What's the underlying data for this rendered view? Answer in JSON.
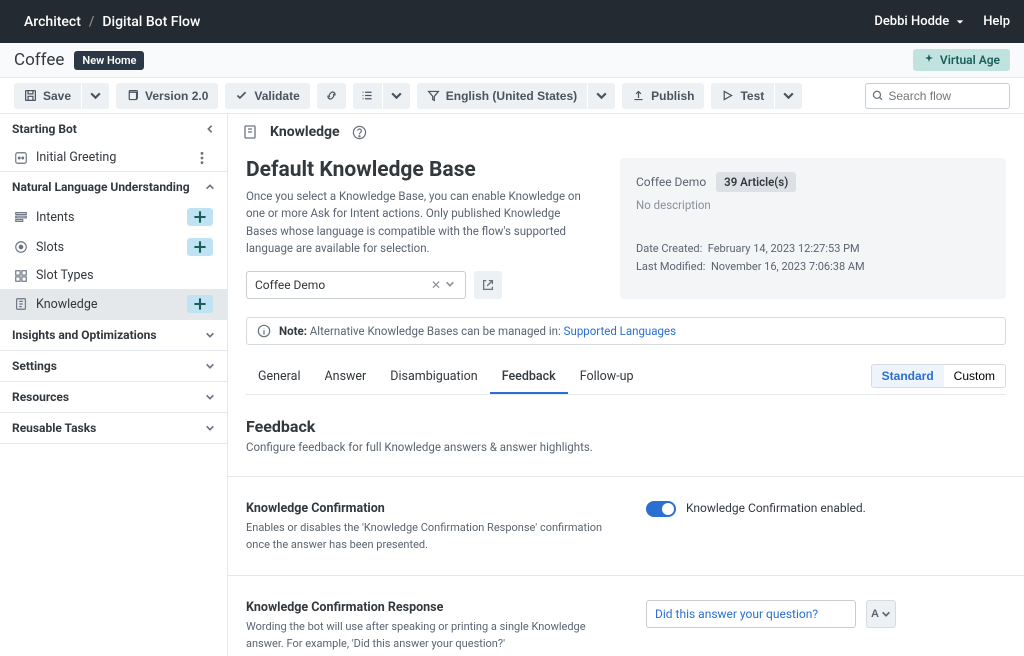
{
  "topbar": {
    "breadcrumb1": "Architect",
    "breadcrumb2": "Digital Bot Flow",
    "user": "Debbi Hodde",
    "help": "Help"
  },
  "subheader": {
    "title": "Coffee",
    "pill": "New Home",
    "va": "Virtual Age"
  },
  "toolbar": {
    "save": "Save",
    "version": "Version 2.0",
    "validate": "Validate",
    "language": "English (United States)",
    "publish": "Publish",
    "test": "Test",
    "search_placeholder": "Search flow"
  },
  "sidebar": {
    "starting_bot": "Starting Bot",
    "initial_greeting": "Initial Greeting",
    "nlu": "Natural Language Understanding",
    "intents": "Intents",
    "slots": "Slots",
    "slot_types": "Slot Types",
    "knowledge": "Knowledge",
    "insights": "Insights and Optimizations",
    "settings": "Settings",
    "resources": "Resources",
    "reusable": "Reusable Tasks"
  },
  "content": {
    "head": "Knowledge",
    "kb_title": "Default Knowledge Base",
    "kb_desc": "Once you select a Knowledge Base, you can enable Knowledge on one or more Ask for Intent actions. Only published Knowledge Bases whose language is compatible with the flow's supported language are available for selection.",
    "kb_selected": "Coffee Demo",
    "kb_name": "Coffee Demo",
    "kb_badge": "39 Article(s)",
    "kb_nodesc": "No description",
    "kb_created_label": "Date Created:",
    "kb_created_val": "February 14, 2023 12:27:53 PM",
    "kb_modified_label": "Last Modified:",
    "kb_modified_val": "November 16, 2023 7:06:38 AM",
    "note_label": "Note:",
    "note_text": " Alternative Knowledge Bases can be managed in: ",
    "note_link": "Supported Languages",
    "tabs": {
      "general": "General",
      "answer": "Answer",
      "disamb": "Disambiguation",
      "feedback": "Feedback",
      "followup": "Follow-up"
    },
    "seg": {
      "standard": "Standard",
      "custom": "Custom"
    },
    "feedback_h": "Feedback",
    "feedback_sub": "Configure feedback for full Knowledge answers & answer highlights.",
    "kc_h": "Knowledge Confirmation",
    "kc_p": "Enables or disables the 'Knowledge Confirmation Response' confirmation once the answer has been presented.",
    "kc_toggle": "Knowledge Confirmation enabled.",
    "kcr_h": "Knowledge Confirmation Response",
    "kcr_p": "Wording the bot will use after speaking or printing a single Knowledge answer. For example, 'Did this answer your question?'",
    "kcr_input": "Did this answer your question?",
    "kcr_ctrl": "A"
  }
}
